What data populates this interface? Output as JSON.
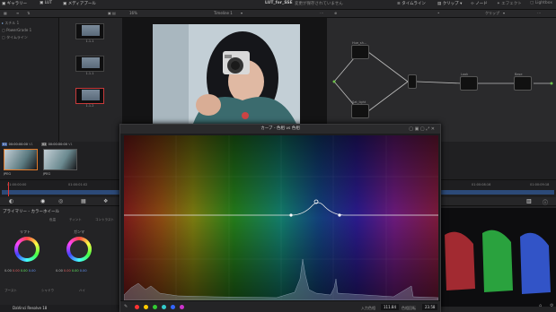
{
  "topbar": {
    "gallery": "ギャラリー",
    "lut": "LUT",
    "media_pool": "メディアプール",
    "project_title": "LUT_for_SSE",
    "unsaved": "変更が保存されていません",
    "timeline": "タイムライン",
    "clip": "クリップ",
    "node": "ノード",
    "effects": "エフェクト",
    "lightbox": "Lightbox"
  },
  "bar2": {
    "zoom": "16%",
    "timeline_name": "Timeline 1",
    "clip": "クリップ"
  },
  "gallery": {
    "items": [
      "スチル 1",
      "PowerGrade 1",
      "タイムライン"
    ]
  },
  "stills": [
    {
      "label": "1.1.1"
    },
    {
      "label": "1.1.1"
    },
    {
      "label": "1.1.2"
    }
  ],
  "nodes": [
    {
      "label": "Hue_sh..."
    },
    {
      "label": "Sat_light"
    },
    {
      "label": "Look"
    },
    {
      "label": "Base"
    }
  ],
  "clips": [
    {
      "num": "01",
      "tc": "00:00:00:00",
      "track": "V1",
      "codec": "JPEG"
    },
    {
      "num": "02",
      "tc": "00:00:00:00",
      "track": "V1",
      "codec": "JPEG"
    }
  ],
  "ruler": {
    "ticks": [
      "01:00:00:00",
      "01:00:01:02",
      "01:00:08:16",
      "01:00:09:18"
    ]
  },
  "primaries": {
    "title": "プライマリー - カラーホイール",
    "contrast_label": "コントラスト",
    "temp_label": "色温",
    "tint_label": "ティント",
    "wheels": [
      {
        "name": "リフト",
        "values": [
          "0.00",
          "0.00",
          "0.00",
          "0.00"
        ]
      },
      {
        "name": "ガンマ",
        "values": [
          "0.00",
          "0.00",
          "0.00",
          "0.00"
        ]
      }
    ],
    "bottom": [
      "ブースト",
      "シャドウ",
      "ハイ"
    ]
  },
  "curve_window": {
    "title": "カーブ - 色相 vs 色相",
    "input_hue_label": "入力色相",
    "input_hue_value": "111.84",
    "hue_rotate_label": "色相回転",
    "hue_rotate_value": "23.58",
    "swatches": [
      "#ff3333",
      "#ffcc00",
      "#33cc33",
      "#33cccc",
      "#3366ff",
      "#cc33cc"
    ]
  },
  "scope": {
    "mode": "パレード"
  },
  "footer": {
    "app": "DaVinci Resolve 18"
  }
}
